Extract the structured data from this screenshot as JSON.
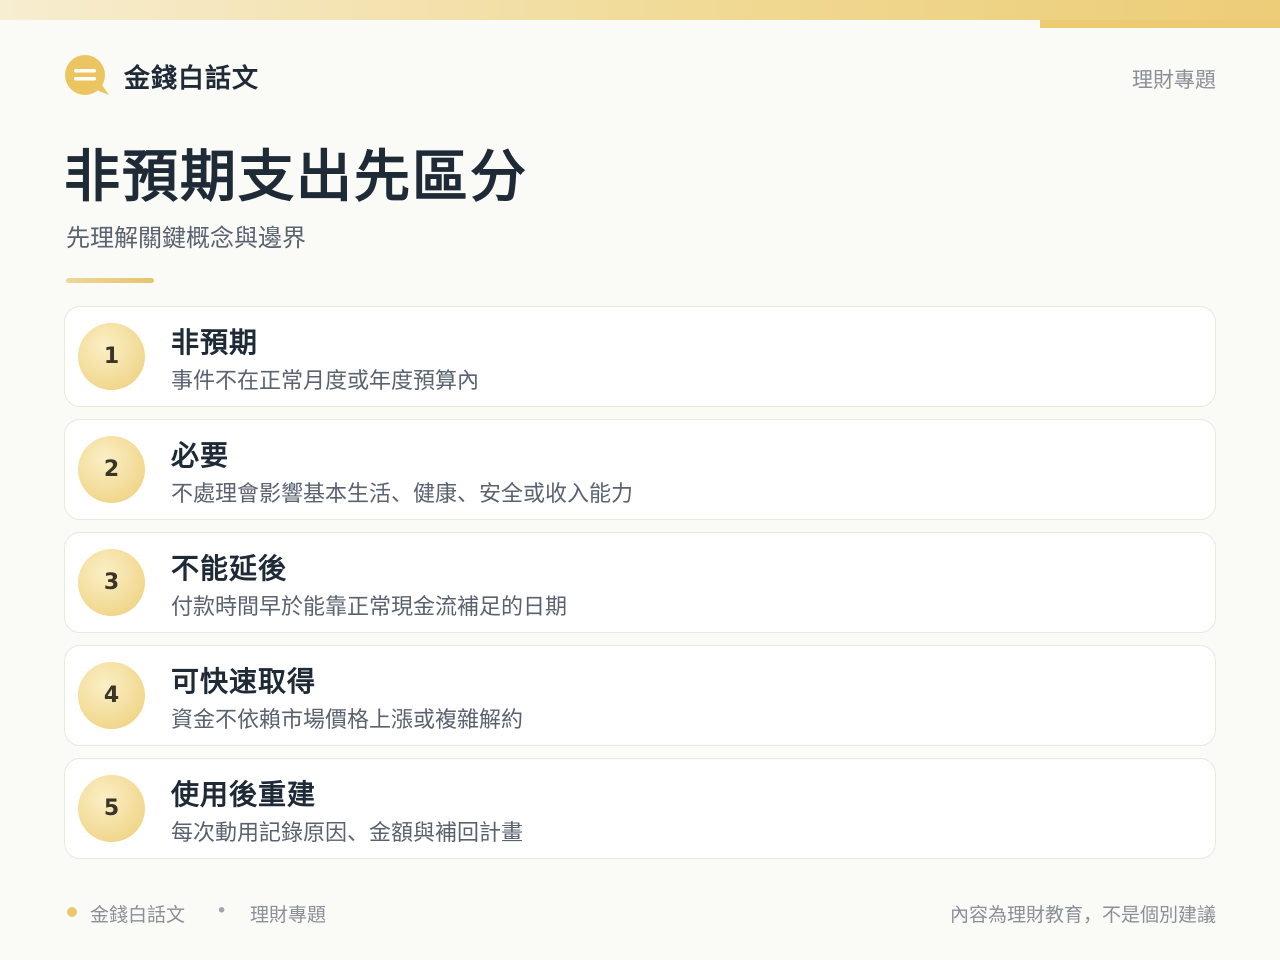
{
  "header": {
    "brand_name": "金錢白話文",
    "brand_icon": "speech-bubble-icon",
    "tag": "理財專題"
  },
  "main": {
    "title": "非預期支出先區分",
    "subtitle": "先理解關鍵概念與邊界"
  },
  "cards": [
    {
      "number": "1",
      "title": "非預期",
      "description": "事件不在正常月度或年度預算內"
    },
    {
      "number": "2",
      "title": "必要",
      "description": "不處理會影響基本生活、健康、安全或收入能力"
    },
    {
      "number": "3",
      "title": "不能延後",
      "description": "付款時間早於能靠正常現金流補足的日期"
    },
    {
      "number": "4",
      "title": "可快速取得",
      "description": "資金不依賴市場價格上漲或複雜解約"
    },
    {
      "number": "5",
      "title": "使用後重建",
      "description": "每次動用記錄原因、金額與補回計畫"
    }
  ],
  "footer": {
    "brand": "金錢白話文",
    "separator": "•",
    "topic": "理財專題",
    "note": "內容為理財教育，不是個別建議"
  },
  "colors": {
    "accent_gold": "#ecc86a",
    "text_dark": "#1f2a37",
    "text_muted": "#5a6270",
    "background": "#fafaf7"
  }
}
